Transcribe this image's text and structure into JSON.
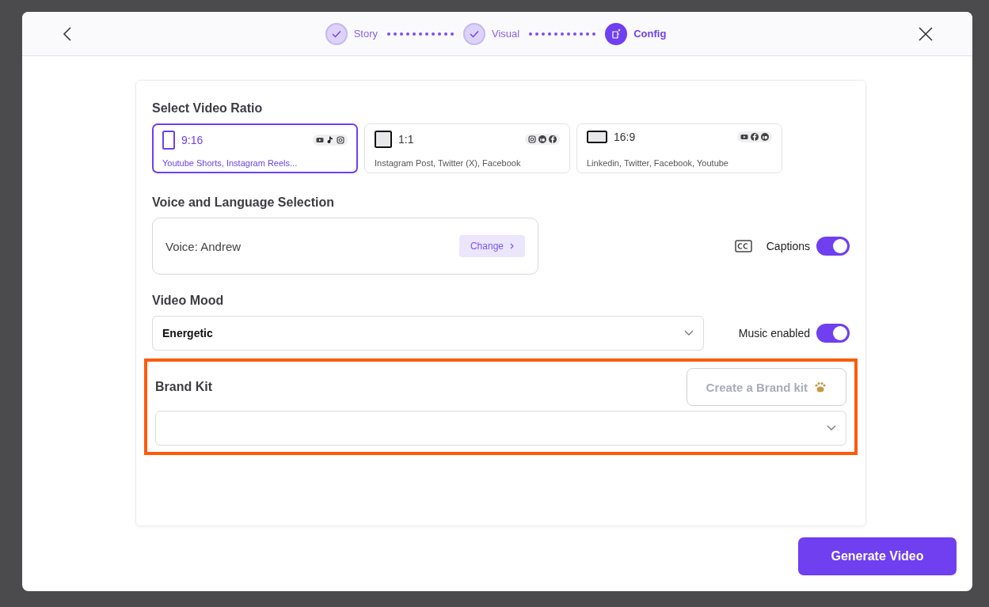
{
  "stepper": {
    "steps": [
      {
        "label": "Story",
        "completed": true,
        "selected": false
      },
      {
        "label": "Visual",
        "completed": true,
        "selected": false
      },
      {
        "label": "Config",
        "completed": false,
        "selected": true
      }
    ]
  },
  "ratio": {
    "title": "Select Video Ratio",
    "options": [
      {
        "label": "9:16",
        "kind": "portrait",
        "platforms": "Youtube Shorts, Instagram Reels...",
        "selected": true,
        "icons": [
          {
            "kind": "video"
          },
          {
            "kind": "note"
          },
          {
            "kind": "camera"
          }
        ]
      },
      {
        "label": "1:1",
        "kind": "square",
        "platforms": "Instagram Post, Twitter (X), Facebook",
        "selected": false,
        "icons": [
          {
            "kind": "camera"
          },
          {
            "kind": "network"
          },
          {
            "kind": "social"
          }
        ]
      },
      {
        "label": "16:9",
        "kind": "landscape",
        "platforms": "Linkedin, Twitter, Facebook, Youtube",
        "selected": false,
        "icons": [
          {
            "kind": "video"
          },
          {
            "kind": "social"
          },
          {
            "kind": "network"
          }
        ]
      }
    ]
  },
  "voice": {
    "title": "Voice and Language Selection",
    "value": "Voice: Andrew",
    "change_button": "Change",
    "captions": {
      "label": "Captions",
      "on": true
    }
  },
  "mood": {
    "title": "Video Mood",
    "value": "Energetic",
    "music": {
      "label": "Music enabled",
      "on": true
    }
  },
  "brand_kit": {
    "title": "Brand Kit",
    "highlighted": true,
    "create_button": {
      "label": "Create a Brand kit",
      "disabled": true
    }
  },
  "generate_button": "Generate Video"
}
